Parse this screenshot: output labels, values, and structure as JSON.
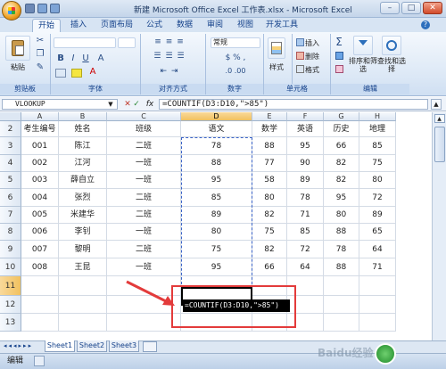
{
  "window": {
    "title": "新建 Microsoft Office Excel 工作表.xlsx - Microsoft Excel",
    "min": "–",
    "max": "□",
    "close": "✕"
  },
  "tabs": [
    "开始",
    "插入",
    "页面布局",
    "公式",
    "数据",
    "审阅",
    "视图",
    "开发工具"
  ],
  "ribbon": {
    "paste": "粘贴",
    "clipboard": "剪贴板",
    "font": "字体",
    "alignment": "对齐方式",
    "number": "数字",
    "number_format": "常规",
    "style": "样式",
    "insert": "插入",
    "delete": "删除",
    "format": "格式",
    "cells": "单元格",
    "sort_filter": "排序和筛选",
    "find_select": "查找和选择",
    "editing": "编辑",
    "bold": "B",
    "italic": "I",
    "underline": "U",
    "font_size_a": "A",
    "sigma": "Σ"
  },
  "formula_bar": {
    "name_box": "VLOOKUP",
    "fx": "fx",
    "formula": "=COUNTIF(D3:D10,\">85\")"
  },
  "columns": [
    "A",
    "B",
    "C",
    "D",
    "E",
    "F",
    "G",
    "H"
  ],
  "rows": [
    "2",
    "3",
    "4",
    "5",
    "6",
    "7",
    "8",
    "9",
    "10",
    "11",
    "12",
    "13"
  ],
  "headers": [
    "考生编号",
    "姓名",
    "班级",
    "语文",
    "数学",
    "英语",
    "历史",
    "地理"
  ],
  "table": [
    [
      "001",
      "陈江",
      "二班",
      "78",
      "88",
      "95",
      "66",
      "85"
    ],
    [
      "002",
      "江河",
      "一班",
      "88",
      "77",
      "90",
      "82",
      "75"
    ],
    [
      "003",
      "薛自立",
      "一班",
      "95",
      "58",
      "89",
      "82",
      "80"
    ],
    [
      "004",
      "张烈",
      "二班",
      "85",
      "80",
      "78",
      "95",
      "72"
    ],
    [
      "005",
      "米建华",
      "二班",
      "89",
      "82",
      "71",
      "80",
      "89"
    ],
    [
      "006",
      "李钊",
      "一班",
      "80",
      "75",
      "85",
      "88",
      "65"
    ],
    [
      "007",
      "黎明",
      "二班",
      "75",
      "82",
      "72",
      "78",
      "64"
    ],
    [
      "008",
      "王昆",
      "一班",
      "95",
      "66",
      "64",
      "88",
      "71"
    ]
  ],
  "editing_cell": {
    "formula": "=COUNTIF(D3:D10,\">85\")"
  },
  "sheets": [
    "Sheet1",
    "Sheet2",
    "Sheet3"
  ],
  "status": {
    "mode": "编辑"
  },
  "watermark": "Baidu经验",
  "colors": {
    "accent": "#15428b",
    "selection": "#f1c15f",
    "arrow": "#e33b3b"
  }
}
